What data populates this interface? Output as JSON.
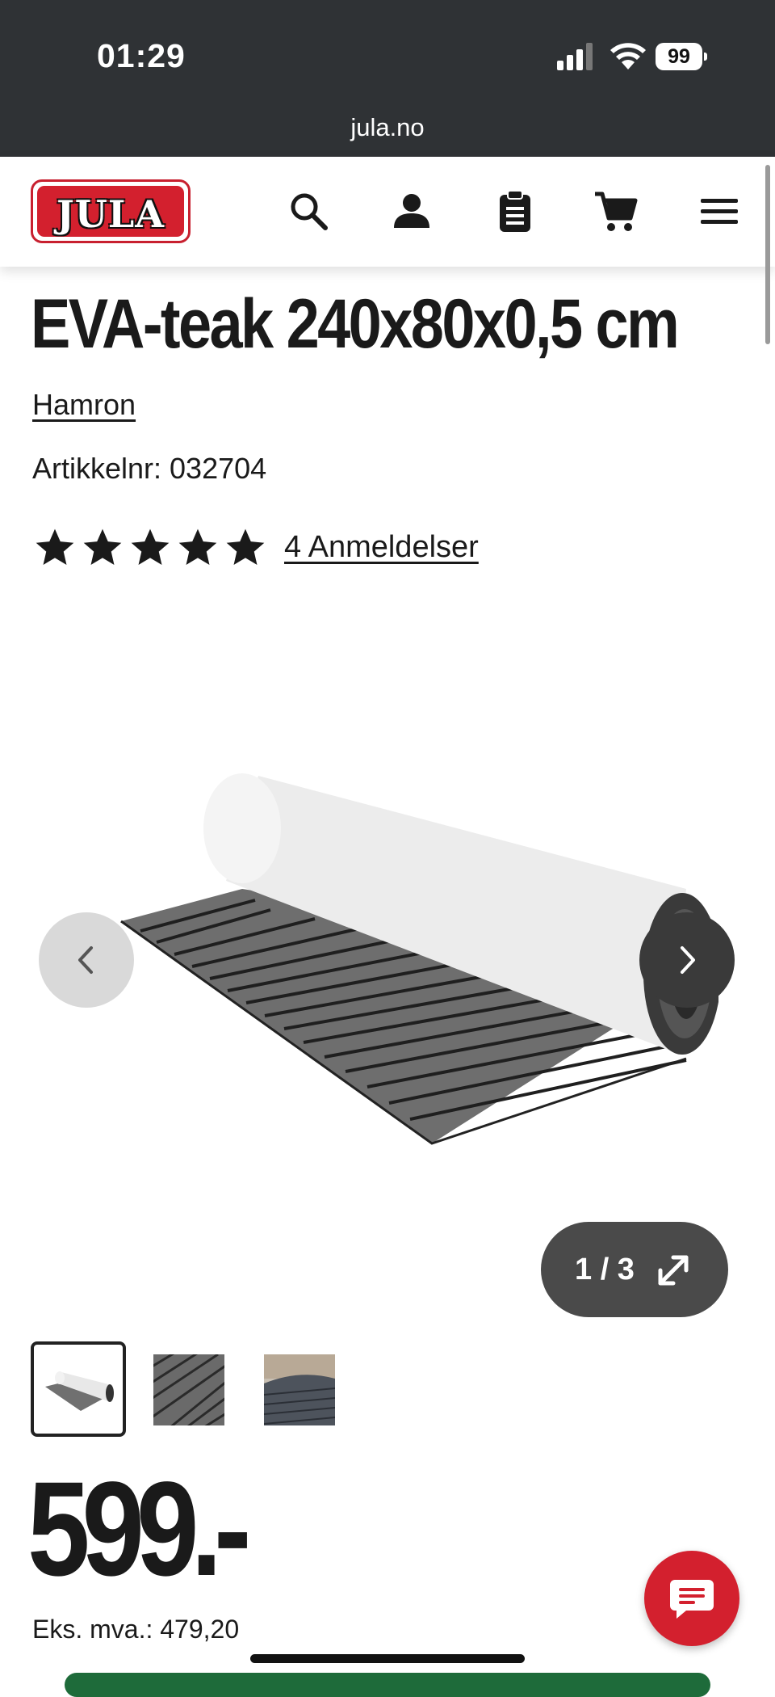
{
  "status_bar": {
    "time": "01:29",
    "battery": "99",
    "url": "jula.no"
  },
  "header": {
    "logo_text": "JULA",
    "icons": [
      "search-icon",
      "account-icon",
      "clipboard-icon",
      "cart-icon",
      "menu-icon"
    ]
  },
  "product": {
    "title": "EVA-teak 240x80x0,5 cm",
    "brand": "Hamron",
    "sku_label": "Artikkelnr: 032704",
    "rating": 5,
    "reviews_label": "4 Anmeldelser"
  },
  "gallery": {
    "counter": "1 / 3",
    "thumbnails": 3
  },
  "price": {
    "value": "599.-",
    "ex_vat": "Eks. mva.: 479,20"
  },
  "colors": {
    "brand_red": "#d3202e",
    "status_bar": "#2f3235"
  }
}
